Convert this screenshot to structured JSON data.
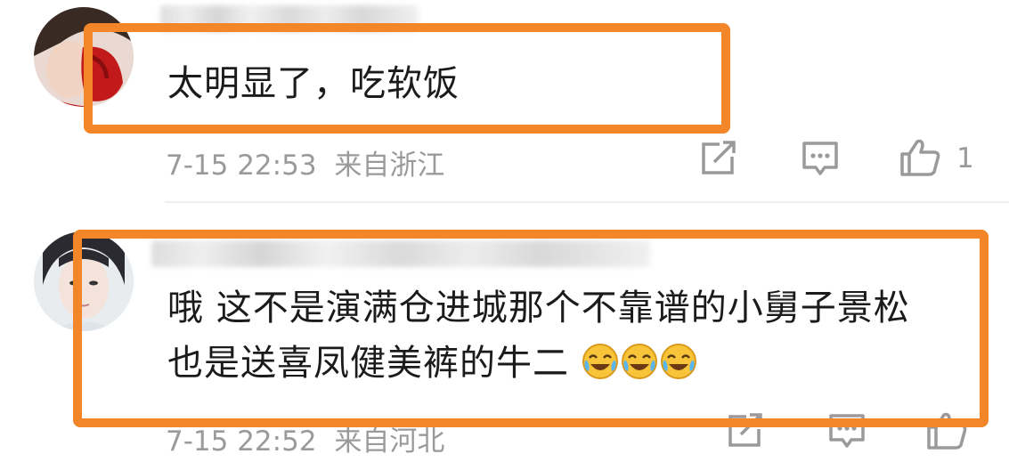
{
  "comments": [
    {
      "text_lines": [
        "太明显了，吃软饭"
      ],
      "timestamp": "7-15 22:53",
      "location": "来自浙江",
      "like_count": "1"
    },
    {
      "text_lines": [
        "哦 这不是演满仓进城那个不靠谱的小舅子景松",
        "也是送喜凤健美裤的牛二"
      ],
      "emoji": [
        "laughing-crying-emoji",
        "laughing-crying-emoji",
        "laughing-crying-emoji"
      ],
      "timestamp": "7-15 22:52",
      "location": "来自河北"
    }
  ],
  "colors": {
    "highlight": "#f4862a",
    "meta_text": "#9a9a9a",
    "body_text": "#1b1b1b"
  },
  "icons": [
    "share-icon",
    "reply-comment-icon",
    "thumbs-up-icon"
  ]
}
